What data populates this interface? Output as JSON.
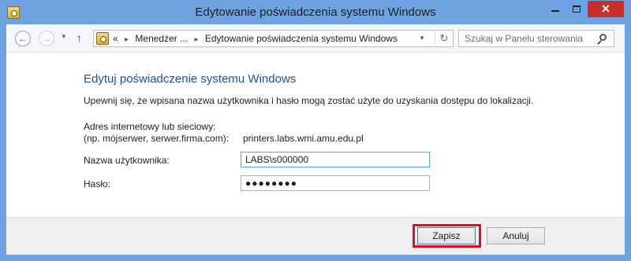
{
  "window": {
    "title": "Edytowanie poświadczenia systemu Windows",
    "controls": {
      "close_label": "✕"
    }
  },
  "navigation": {
    "back_icon": "arrow-left-icon",
    "forward_icon": "arrow-right-icon",
    "up_icon": "arrow-up-icon",
    "breadcrumb": {
      "overflow": "«",
      "items": [
        "Menedżer ...",
        "Edytowanie poświadczenia systemu Windows"
      ]
    },
    "search": {
      "placeholder": "Szukaj w Panelu sterowania"
    }
  },
  "form": {
    "heading": "Edytuj poświadczenie systemu Windows",
    "description": "Upewnij się, że wpisana nazwa użytkownika i hasło mogą zostać użyte do uzyskania dostępu do lokalizacji.",
    "address_label_line1": "Adres internetowy lub sieciowy:",
    "address_label_line2": "(np. mójserwer, serwer.firma.com):",
    "address_value": "printers.labs.wmi.amu.edu.pl",
    "username_label": "Nazwa użytkownika:",
    "username_value": "LABS\\s000000",
    "password_label": "Hasło:",
    "password_value": "●●●●●●●●"
  },
  "buttons": {
    "save": "Zapisz",
    "cancel": "Anuluj"
  },
  "colors": {
    "title_bar": "#6ea2e0",
    "close_button": "#c7312b",
    "heading": "#1e4f9c",
    "highlight": "#e0101a"
  }
}
